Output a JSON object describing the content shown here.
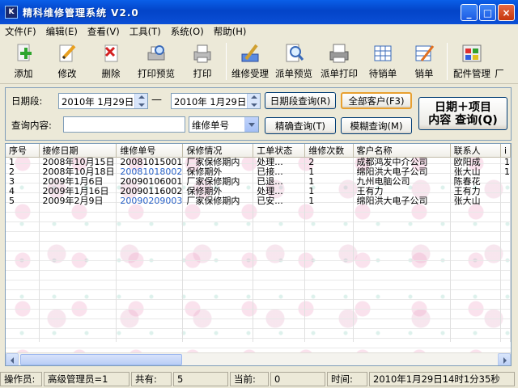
{
  "window": {
    "title": "精科维修管理系统 V2.0",
    "icon_text": "K"
  },
  "menu": [
    "文件(F)",
    "编辑(E)",
    "查看(V)",
    "工具(T)",
    "系统(O)",
    "帮助(H)"
  ],
  "toolbar": [
    {
      "label": "添加",
      "icon": "add-icon"
    },
    {
      "label": "修改",
      "icon": "edit-icon"
    },
    {
      "label": "删除",
      "icon": "delete-icon"
    },
    {
      "label": "打印预览",
      "icon": "print-preview-icon"
    },
    {
      "label": "打印",
      "icon": "print-icon"
    },
    {
      "label": "维修受理",
      "icon": "repair-accept-icon"
    },
    {
      "label": "派单预览",
      "icon": "dispatch-preview-icon"
    },
    {
      "label": "派单打印",
      "icon": "dispatch-print-icon"
    },
    {
      "label": "待销单",
      "icon": "pending-icon"
    },
    {
      "label": "销单",
      "icon": "close-order-icon"
    },
    {
      "label": "配件管理",
      "icon": "parts-icon"
    },
    {
      "label": "厂",
      "icon": "factory-icon"
    }
  ],
  "filter": {
    "date_label": "日期段:",
    "date_from": "2010年 1月29日",
    "dash": "—",
    "date_to": "2010年 1月29日",
    "date_query_btn": "日期段查询(R)",
    "all_customers_btn": "全部客户(F3)",
    "content_label": "查询内容:",
    "content_value": "",
    "field_select": "维修单号",
    "exact_btn": "精确查询(T)",
    "fuzzy_btn": "模糊查询(M)",
    "combo_btn_line1": "日期＋项目",
    "combo_btn_line2": "内容 查询(Q)"
  },
  "table": {
    "columns": [
      "序号",
      "接修日期",
      "维修单号",
      "保修情况",
      "工单状态",
      "维修次数",
      "客户名称",
      "联系人",
      "i"
    ],
    "rows": [
      [
        "1",
        "2008年10月15日",
        "20081015001",
        "厂家保修期内",
        "处理...",
        "2",
        "成都鸿发中介公司",
        "欧阳成",
        "1"
      ],
      [
        "2",
        "2008年10月18日",
        "20081018002",
        "保修期外",
        "已接...",
        "1",
        "绵阳洪大电子公司",
        "张大山",
        "1"
      ],
      [
        "3",
        "2009年1月6日",
        "20090106001",
        "厂家保修期内",
        "已退...",
        "1",
        "九州电脑公司",
        "陈春花",
        ""
      ],
      [
        "4",
        "2009年1月16日",
        "20090116002",
        "保修期外",
        "处理...",
        "1",
        "王有力",
        "王有力",
        ""
      ],
      [
        "5",
        "2009年2月9日",
        "20090209003",
        "厂家保修期内",
        "已安...",
        "1",
        "绵阳洪大电子公司",
        "张大山",
        ""
      ]
    ],
    "blue_ids": [
      1,
      4
    ]
  },
  "status": {
    "operator_label": "操作员:",
    "operator_value": "高级管理员=1",
    "total_label": "共有:",
    "total_value": "5",
    "current_label": "当前:",
    "current_value": "0",
    "time_label": "时间:",
    "time_value": "2010年1月29日14时1分35秒"
  }
}
